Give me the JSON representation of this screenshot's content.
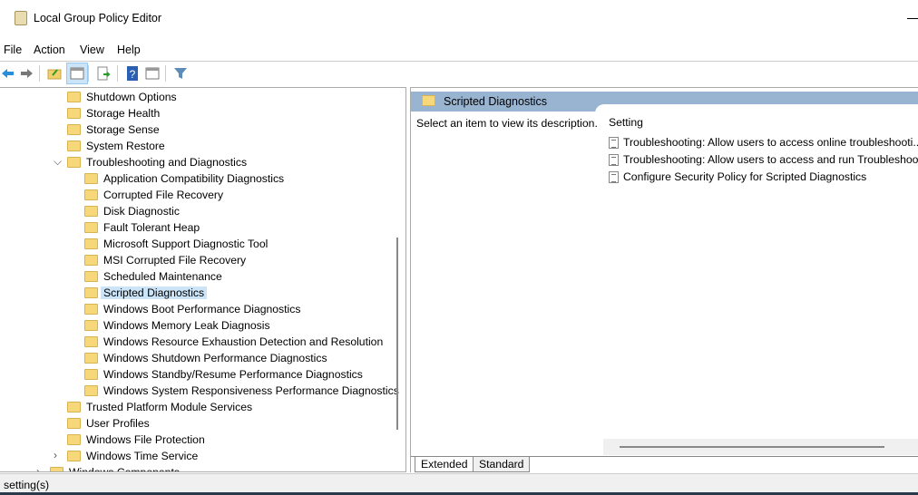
{
  "window": {
    "title": "Local Group Policy Editor"
  },
  "menu": [
    "File",
    "Action",
    "View",
    "Help"
  ],
  "toolbar": [
    "back-icon",
    "forward-icon",
    "up-folder-icon",
    "show-hide-tree-icon",
    "export-list-icon",
    "help-icon",
    "properties-icon",
    "filter-icon"
  ],
  "tree": [
    {
      "label": "Shutdown Options",
      "level": 1
    },
    {
      "label": "Storage Health",
      "level": 1
    },
    {
      "label": "Storage Sense",
      "level": 1
    },
    {
      "label": "System Restore",
      "level": 1
    },
    {
      "label": "Troubleshooting and Diagnostics",
      "level": 1,
      "expanded": true
    },
    {
      "label": "Application Compatibility Diagnostics",
      "level": 2
    },
    {
      "label": "Corrupted File Recovery",
      "level": 2
    },
    {
      "label": "Disk Diagnostic",
      "level": 2
    },
    {
      "label": "Fault Tolerant Heap",
      "level": 2
    },
    {
      "label": "Microsoft Support Diagnostic Tool",
      "level": 2
    },
    {
      "label": "MSI Corrupted File Recovery",
      "level": 2
    },
    {
      "label": "Scheduled Maintenance",
      "level": 2
    },
    {
      "label": "Scripted Diagnostics",
      "level": 2,
      "selected": true
    },
    {
      "label": "Windows Boot Performance Diagnostics",
      "level": 2
    },
    {
      "label": "Windows Memory Leak Diagnosis",
      "level": 2
    },
    {
      "label": "Windows Resource Exhaustion Detection and Resolution",
      "level": 2
    },
    {
      "label": "Windows Shutdown Performance Diagnostics",
      "level": 2
    },
    {
      "label": "Windows Standby/Resume Performance Diagnostics",
      "level": 2
    },
    {
      "label": "Windows System Responsiveness Performance Diagnostics",
      "level": 2
    },
    {
      "label": "Trusted Platform Module Services",
      "level": 1
    },
    {
      "label": "User Profiles",
      "level": 1
    },
    {
      "label": "Windows File Protection",
      "level": 1
    },
    {
      "label": "Windows Time Service",
      "level": 1,
      "collapsed": true
    },
    {
      "label": "Windows Components",
      "level": 0,
      "collapsed": true
    }
  ],
  "detail": {
    "header": "Scripted Diagnostics",
    "description": "Select an item to view its description.",
    "column": "Setting",
    "settings": [
      "Troubleshooting: Allow users to access online troubleshooti...",
      "Troubleshooting: Allow users to access and run Troubleshoo...",
      "Configure Security Policy for Scripted Diagnostics"
    ],
    "tabs": [
      "Extended",
      "Standard"
    ]
  },
  "status": "setting(s)"
}
